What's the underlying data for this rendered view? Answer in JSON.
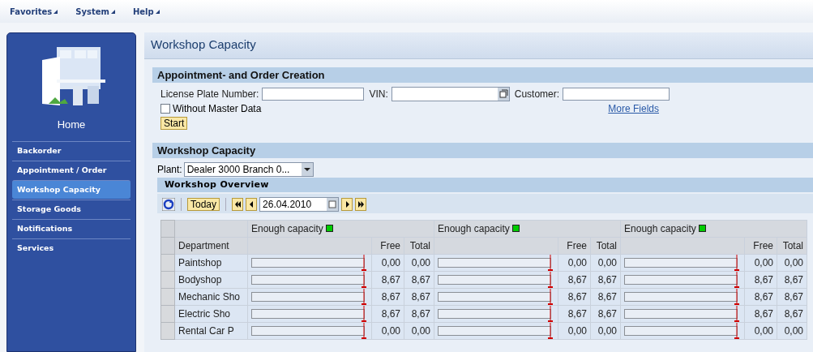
{
  "menu": [
    {
      "label": "Favorites"
    },
    {
      "label": "System"
    },
    {
      "label": "Help"
    }
  ],
  "sidebar": {
    "home_label": "Home",
    "items": [
      {
        "label": "Backorder",
        "selected": false
      },
      {
        "label": "Appointment / Order",
        "selected": false
      },
      {
        "label": "Workshop Capacity",
        "selected": true
      },
      {
        "label": "Storage Goods",
        "selected": false
      },
      {
        "label": "Notifications",
        "selected": false
      },
      {
        "label": "Services",
        "selected": false
      }
    ]
  },
  "page_title": "Workshop Capacity",
  "appointment": {
    "title": "Appointment- and Order Creation",
    "fields": [
      {
        "label": "License Plate Number:",
        "kind": "text"
      },
      {
        "label": "VIN:",
        "kind": "picker"
      },
      {
        "label": "Customer:",
        "kind": "text"
      }
    ],
    "without_master_data": {
      "label": "Without Master Data",
      "checked": false
    },
    "more_fields_link": "More Fields",
    "start_button": "Start"
  },
  "capacity": {
    "title": "Workshop Capacity",
    "plant_label": "Plant:",
    "plant_value": "Dealer 3000 Branch 0...",
    "overview": {
      "title": "Workshop Overview",
      "today_button": "Today",
      "date": "26.04.2010",
      "department_header": "Department",
      "days": [
        {
          "status": "Enough capacity",
          "color": "#00cc00",
          "free_header": "Free",
          "total_header": "Total"
        },
        {
          "status": "Enough capacity",
          "color": "#00cc00",
          "free_header": "Free",
          "total_header": "Total"
        },
        {
          "status": "Enough capacity",
          "color": "#00cc00",
          "free_header": "Free",
          "total_header": "Total"
        }
      ],
      "rows": [
        {
          "department": "Paintshop",
          "cells": [
            {
              "level": 0,
              "free": "0,00",
              "total": "0,00"
            },
            {
              "level": 0,
              "free": "0,00",
              "total": "0,00"
            },
            {
              "level": 0,
              "free": "0,00",
              "total": "0,00"
            }
          ]
        },
        {
          "department": "Bodyshop",
          "cells": [
            {
              "level": 0,
              "free": "8,67",
              "total": "8,67"
            },
            {
              "level": 0,
              "free": "8,67",
              "total": "8,67"
            },
            {
              "level": 0,
              "free": "8,67",
              "total": "8,67"
            }
          ]
        },
        {
          "department": "Mechanic Sho",
          "cells": [
            {
              "level": 0,
              "free": "8,67",
              "total": "8,67"
            },
            {
              "level": 0,
              "free": "8,67",
              "total": "8,67"
            },
            {
              "level": 0,
              "free": "8,67",
              "total": "8,67"
            }
          ]
        },
        {
          "department": "Electric Sho",
          "cells": [
            {
              "level": 0,
              "free": "8,67",
              "total": "8,67"
            },
            {
              "level": 0,
              "free": "8,67",
              "total": "8,67"
            },
            {
              "level": 0,
              "free": "8,67",
              "total": "8,67"
            }
          ]
        },
        {
          "department": "Rental Car P",
          "cells": [
            {
              "level": 0,
              "free": "0,00",
              "total": "0,00"
            },
            {
              "level": 0,
              "free": "0,00",
              "total": "0,00"
            },
            {
              "level": 0,
              "free": "0,00",
              "total": "0,00"
            }
          ]
        }
      ]
    }
  }
}
